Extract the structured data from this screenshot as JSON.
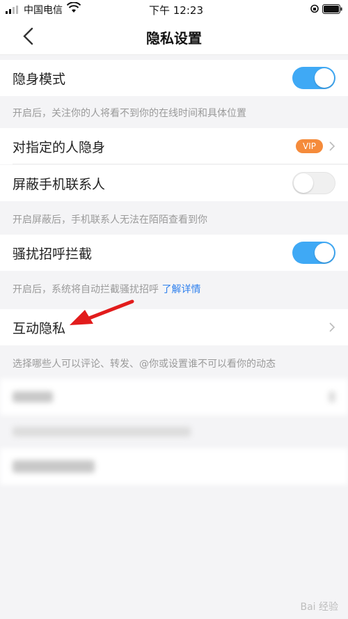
{
  "status_bar": {
    "carrier": "中国电信",
    "time": "下午 12:23"
  },
  "header": {
    "title": "隐私设置"
  },
  "rows": {
    "stealth_mode": {
      "label": "隐身模式",
      "toggle": "on"
    },
    "stealth_note": "开启后，关注你的人将看不到你的在线时间和具体位置",
    "stealth_specific": {
      "label": "对指定的人隐身",
      "badge": "VIP"
    },
    "block_contacts": {
      "label": "屏蔽手机联系人",
      "toggle": "off"
    },
    "block_contacts_note": "开启屏蔽后，手机联系人无法在陌陌查看到你",
    "harassment_block": {
      "label": "骚扰招呼拦截",
      "toggle": "on"
    },
    "harassment_note": "开启后，系统将自动拦截骚扰招呼",
    "harassment_link": "了解详情",
    "interaction_privacy": {
      "label": "互动隐私"
    },
    "interaction_note": "选择哪些人可以评论、转发、@你或设置谁不可以看你的动态"
  },
  "colors": {
    "accent": "#3fa9f5",
    "vip": "#f58b3b",
    "link": "#2f80ed",
    "arrow": "#e21c1c"
  },
  "watermark": "Bai 经验"
}
